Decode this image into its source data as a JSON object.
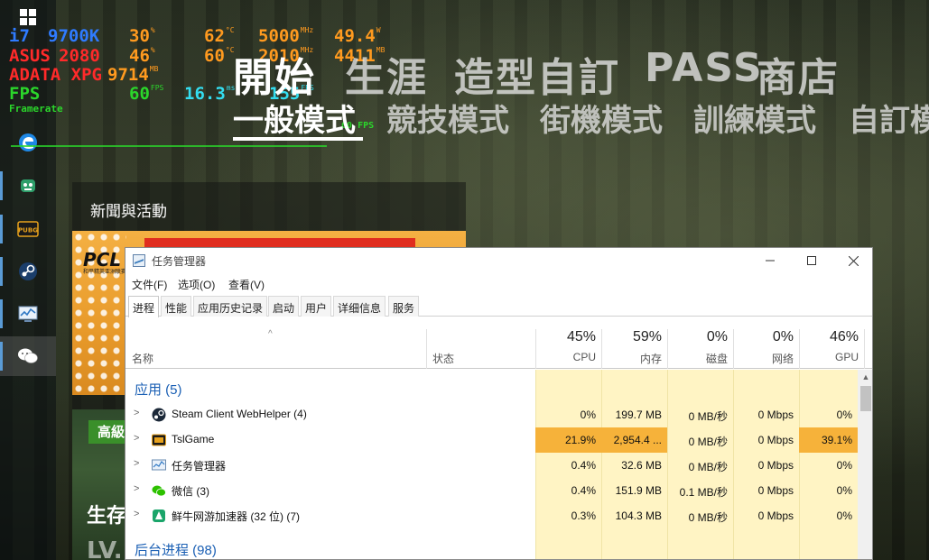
{
  "osd": {
    "cpu": {
      "label": "i7",
      "model": "9700K",
      "load": "30",
      "load_unit": "%",
      "temp": "62",
      "temp_unit": "°C",
      "clock": "5000",
      "clock_unit": "MHz",
      "power": "49.4",
      "power_unit": "W"
    },
    "gpu": {
      "label": "ASUS",
      "model": "2080",
      "load": "46",
      "load_unit": "%",
      "temp": "60",
      "temp_unit": "°C",
      "clock": "2010",
      "clock_unit": "MHz",
      "mem": "4411",
      "mem_unit": "MB"
    },
    "ram": {
      "label": "ADATA XPG",
      "value": "9714",
      "unit": "MB"
    },
    "fps": {
      "label": "FPS",
      "value": "60",
      "unit": "FPS",
      "frametime": "16.3",
      "frametime_unit": "ms",
      "max": "155",
      "max_unit": "FPS"
    },
    "framerate": {
      "label": "Framerate",
      "value": "60",
      "unit": "FPS"
    }
  },
  "game": {
    "top_menu": [
      "開始",
      "生涯",
      "造型自訂",
      "PASS",
      "商店"
    ],
    "sub_menu": [
      "一般模式",
      "競技模式",
      "街機模式",
      "訓練模式",
      "自訂模"
    ],
    "news_title": "新聞與活動",
    "banner1_logo": "PCL",
    "banner1_sub": "和平精英亚洲联赛",
    "banner2_badge": "高級",
    "banner2_title": "生存",
    "banner2_sub": "LV."
  },
  "taskmanager": {
    "title": "任务管理器",
    "menu": [
      "文件(F)",
      "选项(O)",
      "查看(V)"
    ],
    "tabs": [
      "进程",
      "性能",
      "应用历史记录",
      "启动",
      "用户",
      "详细信息",
      "服务"
    ],
    "name_col": "名称",
    "status_col": "状态",
    "columns": [
      {
        "pct": "45%",
        "name": "CPU"
      },
      {
        "pct": "59%",
        "name": "内存"
      },
      {
        "pct": "0%",
        "name": "磁盘"
      },
      {
        "pct": "0%",
        "name": "网络"
      },
      {
        "pct": "46%",
        "name": "GPU"
      }
    ],
    "group_apps": "应用 (5)",
    "group_bg": "后台进程 (98)",
    "rows": [
      {
        "name": "Steam Client WebHelper (4)",
        "cpu": "0%",
        "mem": "199.7 MB",
        "disk": "0 MB/秒",
        "net": "0 Mbps",
        "gpu": "0%"
      },
      {
        "name": "TslGame",
        "cpu": "21.9%",
        "mem": "2,954.4 ...",
        "disk": "0 MB/秒",
        "net": "0 Mbps",
        "gpu": "39.1%"
      },
      {
        "name": "任务管理器",
        "cpu": "0.4%",
        "mem": "32.6 MB",
        "disk": "0 MB/秒",
        "net": "0 Mbps",
        "gpu": "0%"
      },
      {
        "name": "微信 (3)",
        "cpu": "0.4%",
        "mem": "151.9 MB",
        "disk": "0.1 MB/秒",
        "net": "0 Mbps",
        "gpu": "0%"
      },
      {
        "name": "鲜牛网游加速器 (32 位) (7)",
        "cpu": "0.3%",
        "mem": "104.3 MB",
        "disk": "0 MB/秒",
        "net": "0 Mbps",
        "gpu": "0%"
      }
    ],
    "colors": {
      "light": "#fff4c4",
      "medium": "#ffd08a",
      "heavy": "#f6b23a"
    }
  },
  "taskbar_icons": [
    "windows-start-icon",
    "edge-icon",
    "game-helper-icon",
    "pubg-icon",
    "steam-icon",
    "task-manager-icon",
    "wechat-icon"
  ]
}
